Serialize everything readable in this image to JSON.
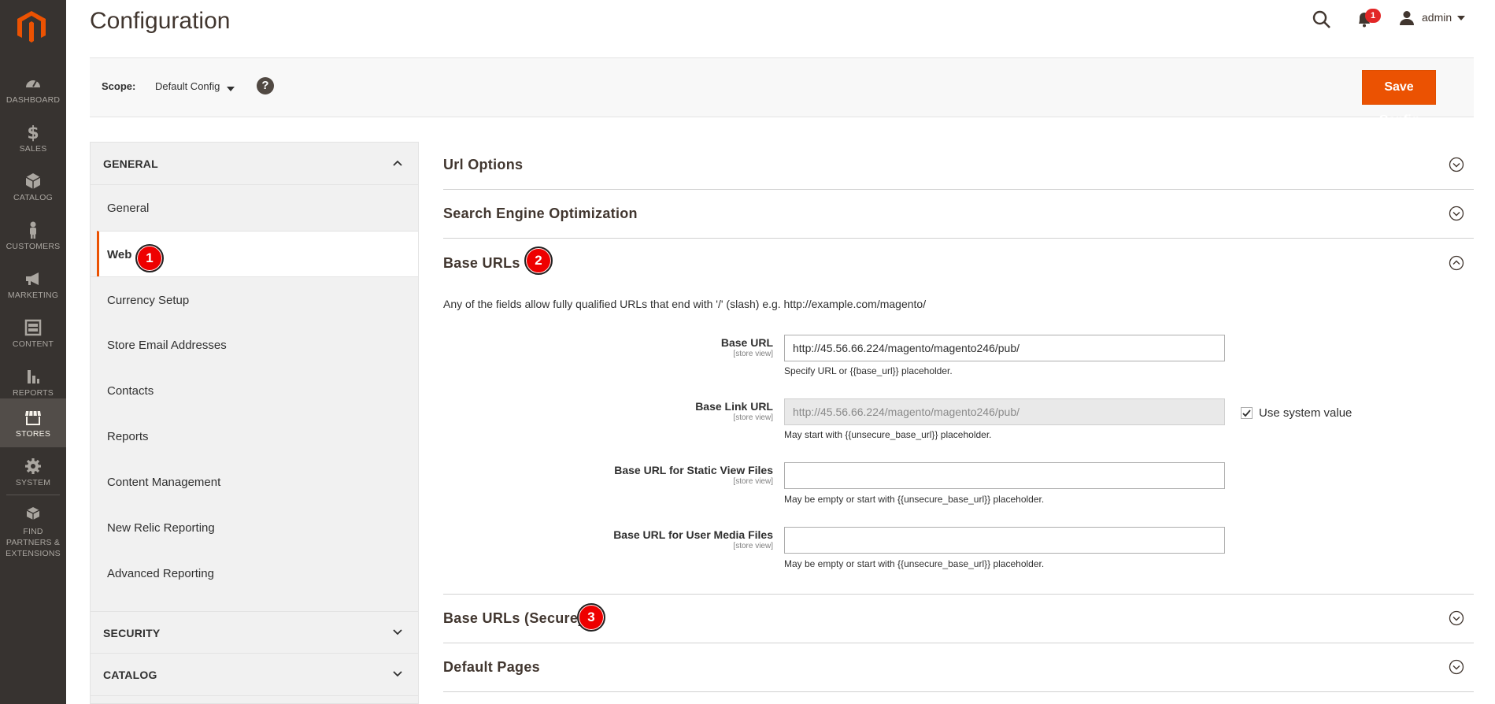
{
  "header": {
    "title": "Configuration",
    "username": "admin",
    "notifications_count": "1"
  },
  "menu": {
    "items": [
      {
        "label": "DASHBOARD"
      },
      {
        "label": "SALES"
      },
      {
        "label": "CATALOG"
      },
      {
        "label": "CUSTOMERS"
      },
      {
        "label": "MARKETING"
      },
      {
        "label": "CONTENT"
      },
      {
        "label": "REPORTS"
      },
      {
        "label": "STORES"
      },
      {
        "label": "SYSTEM"
      },
      {
        "label": "FIND PARTNERS & EXTENSIONS"
      }
    ],
    "active": "STORES"
  },
  "scope": {
    "label": "Scope:",
    "value": "Default Config",
    "help": "?",
    "save_label": "Save Config"
  },
  "sidebar": {
    "sections": [
      {
        "title": "GENERAL"
      },
      {
        "title": "SECURITY"
      },
      {
        "title": "CATALOG"
      }
    ],
    "items": [
      {
        "label": "General"
      },
      {
        "label": "Web"
      },
      {
        "label": "Currency Setup"
      },
      {
        "label": "Store Email Addresses"
      },
      {
        "label": "Contacts"
      },
      {
        "label": "Reports"
      },
      {
        "label": "Content Management"
      },
      {
        "label": "New Relic Reporting"
      },
      {
        "label": "Advanced Reporting"
      }
    ]
  },
  "steps": {
    "one": "1",
    "two": "2",
    "three": "3"
  },
  "groups": {
    "url_options": "Url Options",
    "seo": "Search Engine Optimization",
    "base_urls": "Base URLs",
    "base_urls_secure": "Base URLs (Secure)",
    "default_pages": "Default Pages"
  },
  "base_urls": {
    "intro": "Any of the fields allow fully qualified URLs that end with '/' (slash) e.g. http://example.com/magento/",
    "scope_tag": "[store view]",
    "fields": [
      {
        "label": "Base URL",
        "value": "http://45.56.66.224/magento/magento246/pub/",
        "note": "Specify URL or {{base_url}} placeholder."
      },
      {
        "label": "Base Link URL",
        "value": "http://45.56.66.224/magento/magento246/pub/",
        "note": "May start with {{unsecure_base_url}} placeholder."
      },
      {
        "label": "Base URL for Static View Files",
        "value": "",
        "note": "May be empty or start with {{unsecure_base_url}} placeholder."
      },
      {
        "label": "Base URL for User Media Files",
        "value": "",
        "note": "May be empty or start with {{unsecure_base_url}} placeholder."
      }
    ],
    "use_system_value": "Use system value"
  }
}
